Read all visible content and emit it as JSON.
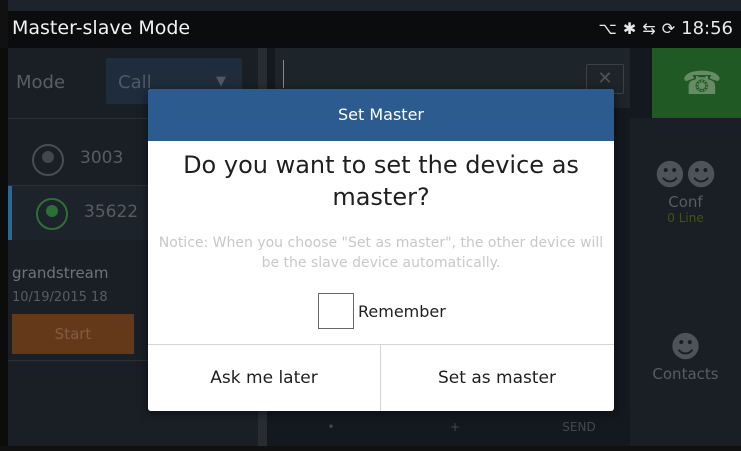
{
  "statusbar": {
    "title": "Master-slave Mode",
    "icons": [
      "usb-icon",
      "bluetooth-icon",
      "network-icon",
      "sync-icon"
    ],
    "clock": "18:56"
  },
  "app": {
    "mode_label": "Mode",
    "mode_value": "Call",
    "accounts": [
      "3003",
      "35622"
    ],
    "conference": {
      "name": "grandstream",
      "date": "10/19/2015 18",
      "start_label": "Start"
    },
    "right_items": [
      {
        "label": "Conf",
        "sub": "0 Line"
      },
      {
        "label": "Contacts"
      }
    ],
    "keypad_bottom": [
      "•",
      "+",
      "SEND"
    ]
  },
  "dialog": {
    "title": "Set Master",
    "question": "Do you want to set the device as master?",
    "notice": "Notice: When you choose \"Set as master\", the other device will be the slave device automatically.",
    "remember_label": "Remember",
    "remember_checked": false,
    "buttons": {
      "ask_later": "Ask me later",
      "set_master": "Set as master"
    }
  },
  "colors": {
    "dialog_header": "#2c5c8f",
    "call_button": "#2f7c33",
    "start_button": "#8a4f25"
  }
}
